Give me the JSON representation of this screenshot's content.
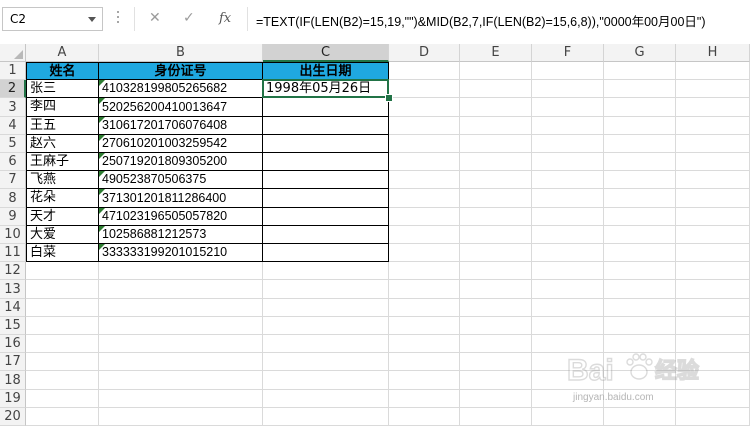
{
  "formula_bar": {
    "name_box": "C2",
    "cancel_icon": "✕",
    "enter_icon": "✓",
    "function_icon": "fx",
    "formula": "=TEXT(IF(LEN(B2)=15,19,\"\")&MID(B2,7,IF(LEN(B2)=15,6,8)),\"0000年00月00日\")"
  },
  "sheet": {
    "columns": [
      "A",
      "B",
      "C",
      "D",
      "E",
      "F",
      "G",
      "H"
    ],
    "rows": [
      "1",
      "2",
      "3",
      "4",
      "5",
      "6",
      "7",
      "8",
      "9",
      "10",
      "11",
      "12",
      "13",
      "14",
      "15",
      "16",
      "17",
      "18",
      "19",
      "20"
    ],
    "selected_cell": "C2",
    "header_fill": "#1fa8e0",
    "selection_color": "#217346",
    "table": {
      "headers": [
        "姓名",
        "身份证号",
        "出生日期"
      ],
      "rows": [
        [
          "张三",
          "410328199805265682",
          "1998年05月26日"
        ],
        [
          "李四",
          "520256200410013647",
          ""
        ],
        [
          "王五",
          "310617201706076408",
          ""
        ],
        [
          "赵六",
          "270610201003259542",
          ""
        ],
        [
          "王麻子",
          "250719201809305200",
          ""
        ],
        [
          "飞燕",
          "490523870506375",
          ""
        ],
        [
          "花朵",
          "371301201811286400",
          ""
        ],
        [
          "天才",
          "471023196505057820",
          ""
        ],
        [
          "大爱",
          "102586881212573",
          ""
        ],
        [
          "白菜",
          "333333199201015210",
          ""
        ]
      ]
    }
  },
  "watermark": {
    "brand": "Bai",
    "paw_icon": "baidu-paw-icon",
    "suffix": "经验",
    "url": "jingyan.baidu.com"
  }
}
